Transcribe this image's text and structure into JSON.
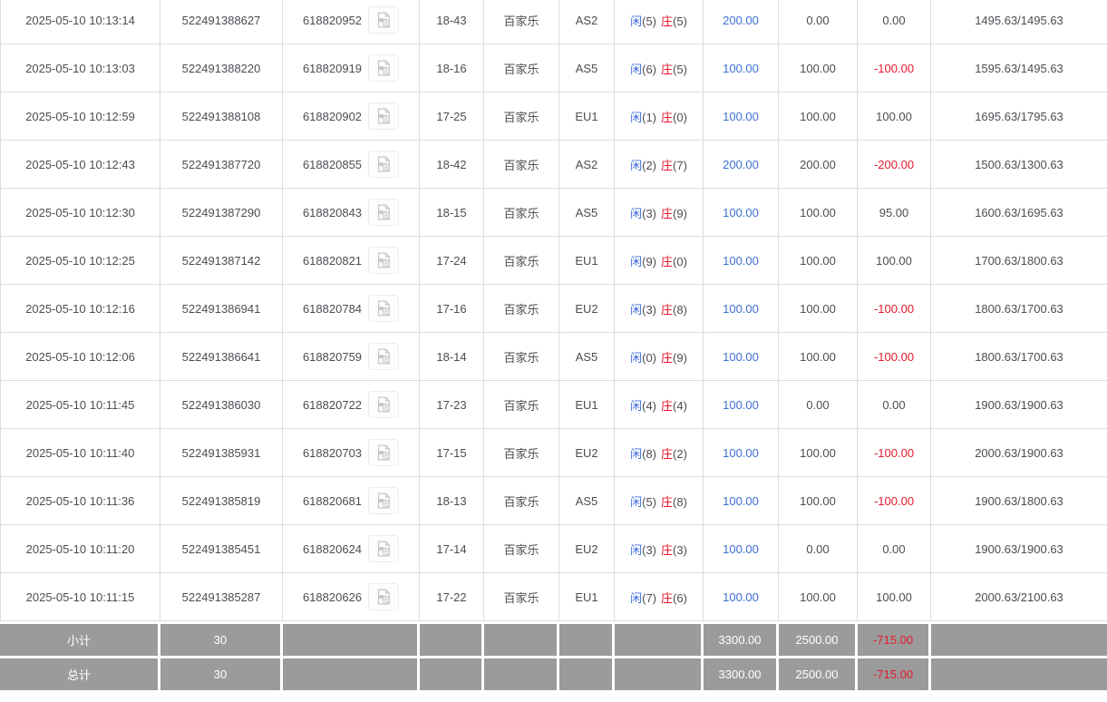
{
  "colors": {
    "text": "#4c4c54",
    "link_blue": "#3c6ed7",
    "negative_red": "#e6192d",
    "grid_line": "#dcdcdc",
    "footer_bg": "#9b9b9b"
  },
  "icons": {
    "video_replay": "video-file-icon"
  },
  "table": {
    "rows": [
      {
        "time": "2025-05-10 10:13:14",
        "bet_id": "522491388627",
        "round_id": "618820952",
        "table_round": "18-43",
        "game": "百家乐",
        "table_code": "AS2",
        "player": "闲",
        "player_score": "(5)",
        "banker": "庄",
        "banker_score": "(5)",
        "bet": "200.00",
        "valid": "0.00",
        "winloss": "0.00",
        "balance": "1495.63/1495.63"
      },
      {
        "time": "2025-05-10 10:13:03",
        "bet_id": "522491388220",
        "round_id": "618820919",
        "table_round": "18-16",
        "game": "百家乐",
        "table_code": "AS5",
        "player": "闲",
        "player_score": "(6)",
        "banker": "庄",
        "banker_score": "(5)",
        "bet": "100.00",
        "valid": "100.00",
        "winloss": "-100.00",
        "balance": "1595.63/1495.63"
      },
      {
        "time": "2025-05-10 10:12:59",
        "bet_id": "522491388108",
        "round_id": "618820902",
        "table_round": "17-25",
        "game": "百家乐",
        "table_code": "EU1",
        "player": "闲",
        "player_score": "(1)",
        "banker": "庄",
        "banker_score": "(0)",
        "bet": "100.00",
        "valid": "100.00",
        "winloss": "100.00",
        "balance": "1695.63/1795.63"
      },
      {
        "time": "2025-05-10 10:12:43",
        "bet_id": "522491387720",
        "round_id": "618820855",
        "table_round": "18-42",
        "game": "百家乐",
        "table_code": "AS2",
        "player": "闲",
        "player_score": "(2)",
        "banker": "庄",
        "banker_score": "(7)",
        "bet": "200.00",
        "valid": "200.00",
        "winloss": "-200.00",
        "balance": "1500.63/1300.63"
      },
      {
        "time": "2025-05-10 10:12:30",
        "bet_id": "522491387290",
        "round_id": "618820843",
        "table_round": "18-15",
        "game": "百家乐",
        "table_code": "AS5",
        "player": "闲",
        "player_score": "(3)",
        "banker": "庄",
        "banker_score": "(9)",
        "bet": "100.00",
        "valid": "100.00",
        "winloss": "95.00",
        "balance": "1600.63/1695.63"
      },
      {
        "time": "2025-05-10 10:12:25",
        "bet_id": "522491387142",
        "round_id": "618820821",
        "table_round": "17-24",
        "game": "百家乐",
        "table_code": "EU1",
        "player": "闲",
        "player_score": "(9)",
        "banker": "庄",
        "banker_score": "(0)",
        "bet": "100.00",
        "valid": "100.00",
        "winloss": "100.00",
        "balance": "1700.63/1800.63"
      },
      {
        "time": "2025-05-10 10:12:16",
        "bet_id": "522491386941",
        "round_id": "618820784",
        "table_round": "17-16",
        "game": "百家乐",
        "table_code": "EU2",
        "player": "闲",
        "player_score": "(3)",
        "banker": "庄",
        "banker_score": "(8)",
        "bet": "100.00",
        "valid": "100.00",
        "winloss": "-100.00",
        "balance": "1800.63/1700.63"
      },
      {
        "time": "2025-05-10 10:12:06",
        "bet_id": "522491386641",
        "round_id": "618820759",
        "table_round": "18-14",
        "game": "百家乐",
        "table_code": "AS5",
        "player": "闲",
        "player_score": "(0)",
        "banker": "庄",
        "banker_score": "(9)",
        "bet": "100.00",
        "valid": "100.00",
        "winloss": "-100.00",
        "balance": "1800.63/1700.63"
      },
      {
        "time": "2025-05-10 10:11:45",
        "bet_id": "522491386030",
        "round_id": "618820722",
        "table_round": "17-23",
        "game": "百家乐",
        "table_code": "EU1",
        "player": "闲",
        "player_score": "(4)",
        "banker": "庄",
        "banker_score": "(4)",
        "bet": "100.00",
        "valid": "0.00",
        "winloss": "0.00",
        "balance": "1900.63/1900.63"
      },
      {
        "time": "2025-05-10 10:11:40",
        "bet_id": "522491385931",
        "round_id": "618820703",
        "table_round": "17-15",
        "game": "百家乐",
        "table_code": "EU2",
        "player": "闲",
        "player_score": "(8)",
        "banker": "庄",
        "banker_score": "(2)",
        "bet": "100.00",
        "valid": "100.00",
        "winloss": "-100.00",
        "balance": "2000.63/1900.63"
      },
      {
        "time": "2025-05-10 10:11:36",
        "bet_id": "522491385819",
        "round_id": "618820681",
        "table_round": "18-13",
        "game": "百家乐",
        "table_code": "AS5",
        "player": "闲",
        "player_score": "(5)",
        "banker": "庄",
        "banker_score": "(8)",
        "bet": "100.00",
        "valid": "100.00",
        "winloss": "-100.00",
        "balance": "1900.63/1800.63"
      },
      {
        "time": "2025-05-10 10:11:20",
        "bet_id": "522491385451",
        "round_id": "618820624",
        "table_round": "17-14",
        "game": "百家乐",
        "table_code": "EU2",
        "player": "闲",
        "player_score": "(3)",
        "banker": "庄",
        "banker_score": "(3)",
        "bet": "100.00",
        "valid": "0.00",
        "winloss": "0.00",
        "balance": "1900.63/1900.63"
      },
      {
        "time": "2025-05-10 10:11:15",
        "bet_id": "522491385287",
        "round_id": "618820626",
        "table_round": "17-22",
        "game": "百家乐",
        "table_code": "EU1",
        "player": "闲",
        "player_score": "(7)",
        "banker": "庄",
        "banker_score": "(6)",
        "bet": "100.00",
        "valid": "100.00",
        "winloss": "100.00",
        "balance": "2000.63/2100.63"
      }
    ],
    "footer": [
      {
        "label": "小计",
        "count": "30",
        "bet": "3300.00",
        "valid": "2500.00",
        "winloss": "-715.00"
      },
      {
        "label": "总计",
        "count": "30",
        "bet": "3300.00",
        "valid": "2500.00",
        "winloss": "-715.00"
      }
    ]
  }
}
